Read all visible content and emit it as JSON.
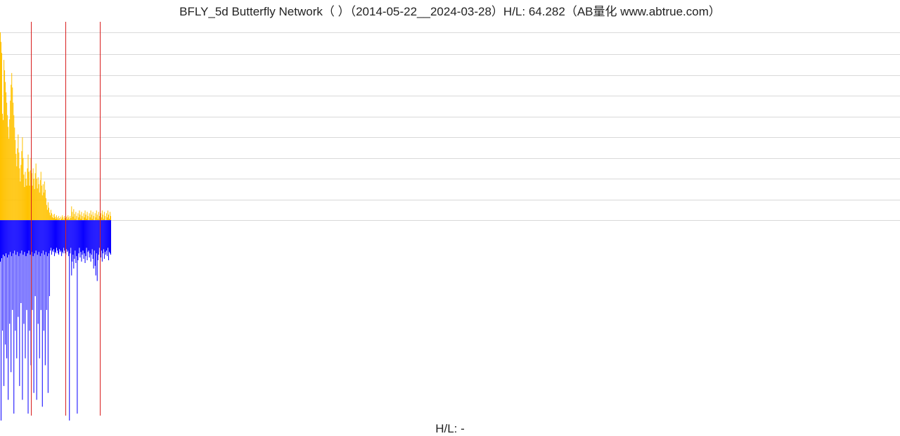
{
  "title": "BFLY_5d Butterfly Network（ ）（2014-05-22__2024-03-28）H/L: 64.282（AB量化  www.abtrue.com）",
  "footer": "H/L: -",
  "chart_data": {
    "type": "bar",
    "title": "BFLY_5d Butterfly Network（ ）（2014-05-22__2024-03-28）H/L: 64.282（AB量化  www.abtrue.com）",
    "xlabel": "",
    "ylabel": "",
    "ylim": [
      -290,
      280
    ],
    "grid_levels_upper": [
      0,
      30,
      60,
      90,
      120,
      150,
      180,
      210,
      240,
      272
    ],
    "marker_indices": [
      43,
      92,
      140
    ],
    "n_bars": 156,
    "series": [
      {
        "name": "upper",
        "color": "#ffc200",
        "values": [
          272,
          258,
          242,
          154,
          145,
          232,
          217,
          200,
          185,
          170,
          152,
          135,
          118,
          146,
          173,
          196,
          213,
          192,
          170,
          152,
          134,
          116,
          96,
          78,
          104,
          124,
          98,
          75,
          56,
          80,
          100,
          120,
          90,
          66,
          48,
          70,
          60,
          50,
          75,
          95,
          70,
          50,
          72,
          90,
          68,
          50,
          75,
          60,
          45,
          68,
          82,
          60,
          46,
          62,
          52,
          40,
          58,
          70,
          50,
          36,
          52,
          40,
          56,
          44,
          32,
          22,
          15,
          26,
          18,
          11,
          7,
          15,
          10,
          4,
          8,
          3,
          9,
          5,
          2,
          7,
          4,
          1,
          6,
          3,
          0,
          5,
          2,
          7,
          4,
          1,
          6,
          3,
          0,
          5,
          2,
          7,
          4,
          1,
          6,
          3,
          20,
          12,
          5,
          16,
          9,
          2,
          12,
          6,
          0,
          10,
          4,
          14,
          8,
          2,
          12,
          6,
          0,
          10,
          4,
          14,
          8,
          2,
          12,
          6,
          0,
          10,
          4,
          14,
          8,
          2,
          12,
          6,
          0,
          10,
          4,
          14,
          8,
          2,
          12,
          6,
          0,
          10,
          4,
          14,
          8,
          2,
          12,
          6,
          0,
          10,
          4,
          14,
          8,
          2,
          12,
          6
        ]
      },
      {
        "name": "lower",
        "color": "#0a00ff",
        "values": [
          -60,
          -290,
          -55,
          -160,
          -50,
          -240,
          -52,
          -180,
          -48,
          -200,
          -54,
          -260,
          -50,
          -150,
          -46,
          -220,
          -52,
          -130,
          -48,
          -280,
          -44,
          -160,
          -50,
          -200,
          -46,
          -140,
          -52,
          -240,
          -48,
          -120,
          -44,
          -260,
          -50,
          -150,
          -46,
          -200,
          -52,
          -130,
          -48,
          -280,
          -44,
          -160,
          -50,
          -210,
          -46,
          -130,
          -52,
          -250,
          -48,
          -110,
          -44,
          -260,
          -50,
          -150,
          -46,
          -200,
          -52,
          -130,
          -48,
          -270,
          -44,
          -160,
          -50,
          -210,
          -46,
          -130,
          -52,
          -250,
          -48,
          -110,
          -44,
          -40,
          -50,
          -44,
          -46,
          -42,
          -52,
          -46,
          -48,
          -40,
          -44,
          -48,
          -50,
          -42,
          -46,
          -44,
          -52,
          -46,
          -48,
          -40,
          -44,
          -48,
          -50,
          -42,
          -46,
          -44,
          -52,
          -290,
          -48,
          -40,
          -80,
          -60,
          -50,
          -70,
          -56,
          -44,
          -62,
          -52,
          -280,
          -58,
          -48,
          -40,
          -54,
          -46,
          -60,
          -50,
          -44,
          -56,
          -48,
          -62,
          -52,
          -40,
          -58,
          -46,
          -44,
          -54,
          -48,
          -60,
          -50,
          -42,
          -56,
          -70,
          -44,
          -66,
          -80,
          -48,
          -88,
          -58,
          -50,
          -40,
          -46,
          -54,
          -44,
          -60,
          -48,
          -42,
          -56,
          -46,
          -50,
          -44,
          -52,
          -40,
          -58,
          -46,
          -48,
          -50
        ]
      }
    ]
  }
}
